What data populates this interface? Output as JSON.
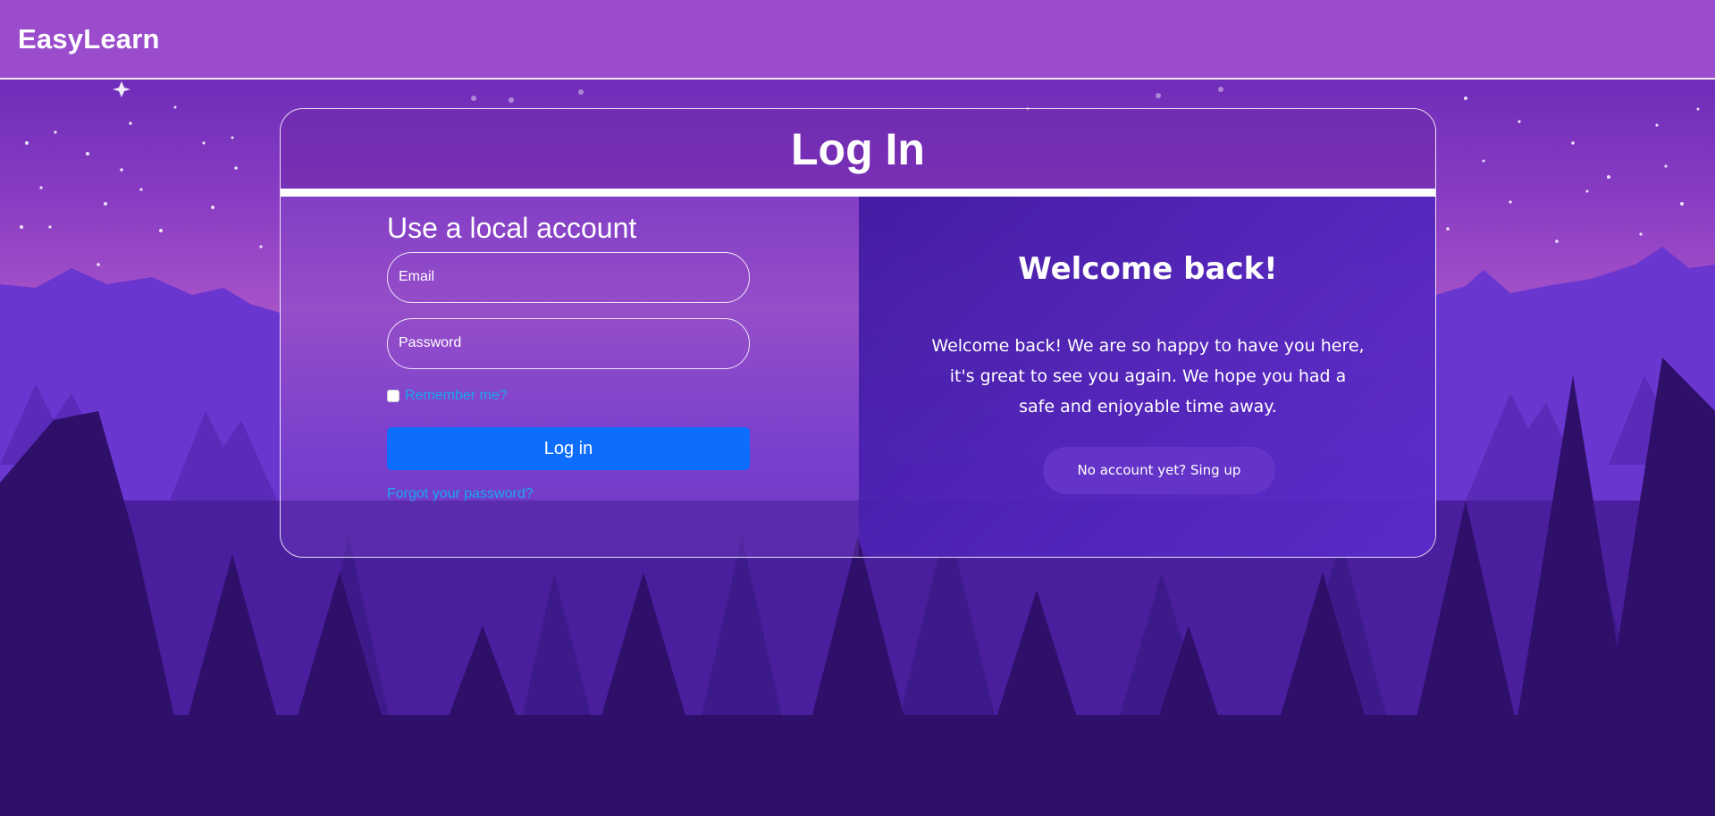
{
  "navbar": {
    "brand": "EasyLearn"
  },
  "login": {
    "title": "Log In",
    "section_title": "Use a local account",
    "email_placeholder": "Email",
    "password_placeholder": "Password",
    "remember_label": "Remember me?",
    "remember_checked": false,
    "login_button": "Log in",
    "forgot_link": "Forgot your password?"
  },
  "welcome": {
    "title": "Welcome back!",
    "text": "Welcome back! We are so happy to have you here, it's great to see you again. We hope you had a safe and enjoyable time away.",
    "signup_button": "No account yet? Sing up"
  },
  "colors": {
    "navbar": "#9a4ccc",
    "primary_button": "#0d6efd",
    "link": "#19a9f0",
    "signup_button": "#6434c8",
    "sky_top": "#6a2bb8",
    "sky_bottom": "#a052c8"
  }
}
